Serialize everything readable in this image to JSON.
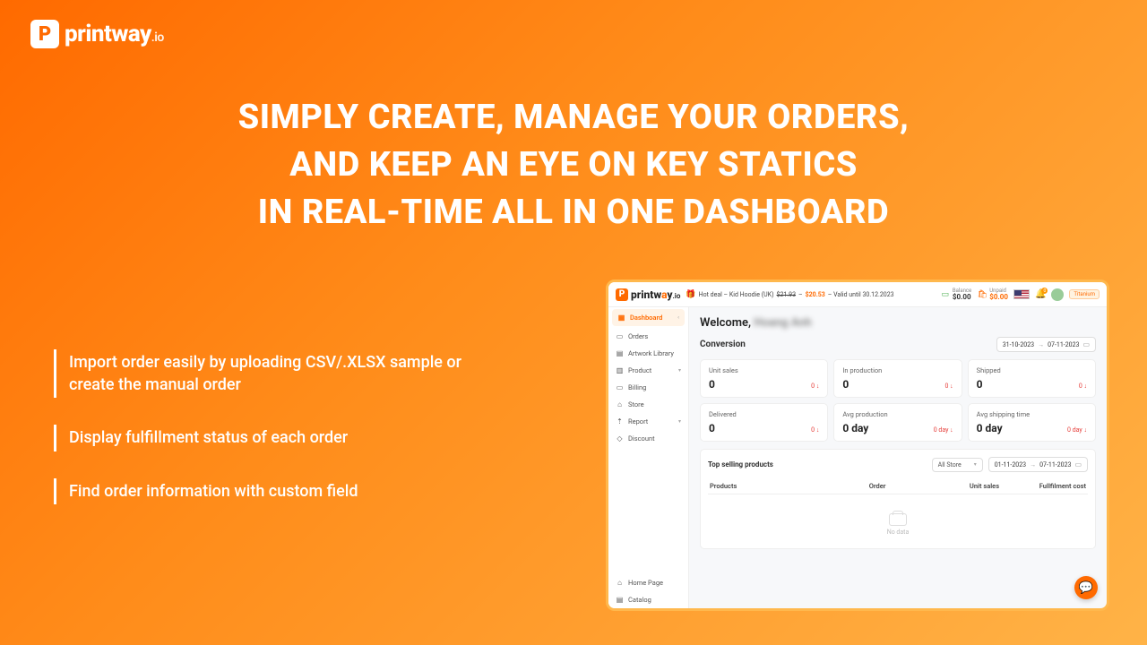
{
  "brand": {
    "name": "printway",
    "suffix": ".io",
    "mark": "P"
  },
  "headline": {
    "line1": "SIMPLY CREATE, MANAGE YOUR ORDERS,",
    "line2": "AND KEEP AN EYE ON KEY STATICS",
    "line3": "IN REAL-TIME ALL IN ONE DASHBOARD"
  },
  "features": [
    "Import order easily by uploading CSV/.XLSX sample or create the manual order",
    "Display fulfillment status of each order",
    "Find order information with custom field"
  ],
  "app": {
    "deal": {
      "prefix": "Hot deal – Kid Hoodie (UK) ",
      "old_price": "$21.93",
      "sep": " – ",
      "new_price": "$20.53",
      "valid": " – Valid until 30.12.2023"
    },
    "balance": {
      "label": "Balance",
      "value": "$0.00"
    },
    "unpaid": {
      "label": "Unpaid",
      "value": "$0.00"
    },
    "notif_count": "0",
    "tier": "Titanium",
    "sidebar": [
      {
        "icon": "▦",
        "label": "Dashboard",
        "active": true,
        "collapse": true
      },
      {
        "icon": "▭",
        "label": "Orders"
      },
      {
        "icon": "▤",
        "label": "Artwork Library"
      },
      {
        "icon": "▥",
        "label": "Product",
        "chev": true
      },
      {
        "icon": "▭",
        "label": "Billing"
      },
      {
        "icon": "⌂",
        "label": "Store"
      },
      {
        "icon": "⇡",
        "label": "Report",
        "chev": true
      },
      {
        "icon": "◇",
        "label": "Discount"
      }
    ],
    "sidebar_bottom": [
      {
        "icon": "⌂",
        "label": "Home Page"
      },
      {
        "icon": "▤",
        "label": "Catalog"
      }
    ],
    "welcome_prefix": "Welcome, ",
    "welcome_name": "Hoang Anh",
    "conversion_title": "Conversion",
    "conv_range": {
      "from": "31-10-2023",
      "to": "07-11-2023"
    },
    "metrics": [
      {
        "label": "Unit sales",
        "value": "0",
        "delta": "0 ↓"
      },
      {
        "label": "In production",
        "value": "0",
        "delta": "0 ↓"
      },
      {
        "label": "Shipped",
        "value": "0",
        "delta": "0 ↓"
      },
      {
        "label": "Delivered",
        "value": "0",
        "delta": "0 ↓"
      },
      {
        "label": "Avg production",
        "value": "0 day",
        "delta": "0 day ↓"
      },
      {
        "label": "Avg shipping time",
        "value": "0 day",
        "delta": "0 day ↓"
      }
    ],
    "top": {
      "title": "Top selling products",
      "store_select": "All Store",
      "range": {
        "from": "01-11-2023",
        "to": "07-11-2023"
      },
      "columns": {
        "products": "Products",
        "order": "Order",
        "units": "Unit sales",
        "cost": "Fullfilment cost"
      },
      "no_data": "No data"
    }
  }
}
